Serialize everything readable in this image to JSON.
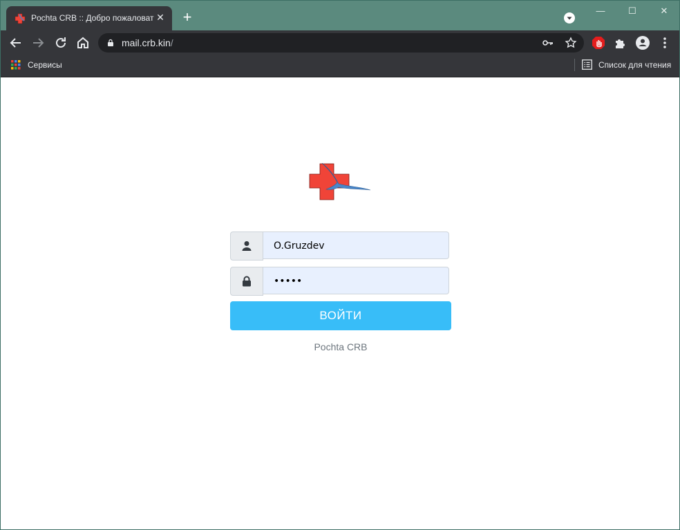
{
  "browser": {
    "tab": {
      "title": "Pochta CRB :: Добро пожаловать",
      "close": "✕"
    },
    "new_tab": "+",
    "window_controls": {
      "minimize": "—",
      "maximize": "☐",
      "close": "✕"
    },
    "url": {
      "host": "mail.crb.kin",
      "path": "/"
    },
    "bookmarks": {
      "apps_label": "Сервисы",
      "reading_list_label": "Список для чтения"
    }
  },
  "login": {
    "username": "O.Gruzdev",
    "password_mask": "•••••",
    "submit_label": "ВОЙТИ",
    "footer": "Pochta CRB"
  },
  "colors": {
    "accent": "#38bdf8",
    "titlebar": "#5b8a7e",
    "logo_cross": "#f04438",
    "logo_bird": "#4a86c8"
  }
}
